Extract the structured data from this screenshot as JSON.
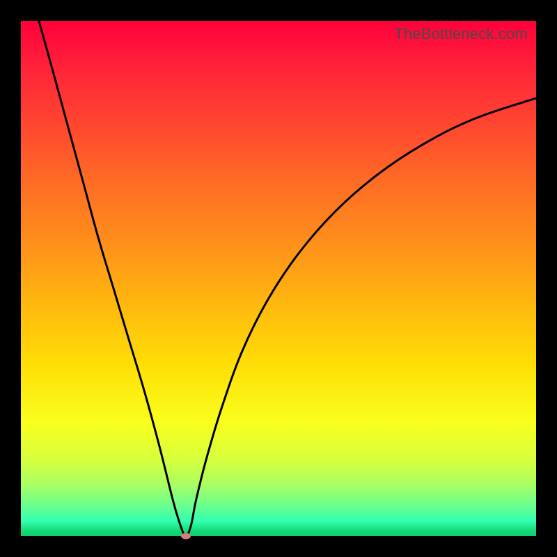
{
  "watermark": "TheBottleneck.com",
  "chart_data": {
    "type": "line",
    "title": "",
    "xlabel": "",
    "ylabel": "",
    "xlim": [
      0,
      100
    ],
    "ylim": [
      0,
      100
    ],
    "grid": false,
    "legend": false,
    "gradient_stops": [
      {
        "pos": 0,
        "color": "#ff003a"
      },
      {
        "pos": 20,
        "color": "#ff4630"
      },
      {
        "pos": 44,
        "color": "#ff921a"
      },
      {
        "pos": 67,
        "color": "#ffdf06"
      },
      {
        "pos": 85,
        "color": "#d8ff3c"
      },
      {
        "pos": 97,
        "color": "#34ffb0"
      },
      {
        "pos": 100,
        "color": "#0fcf70"
      }
    ],
    "series": [
      {
        "name": "bottleneck-curve",
        "color": "#000000",
        "x": [
          3.5,
          6,
          9,
          12,
          15,
          18,
          21,
          24,
          27,
          29.5,
          31,
          32,
          33,
          34,
          36,
          39,
          43,
          48,
          54,
          61,
          69,
          78,
          88,
          100
        ],
        "values": [
          100,
          91,
          80,
          69,
          58,
          48,
          38,
          28,
          17,
          7,
          2,
          0,
          2,
          7,
          15,
          25,
          36,
          46,
          55,
          63,
          70,
          76,
          81,
          85
        ]
      }
    ],
    "marker": {
      "x": 32,
      "y": 0,
      "color": "#d97a7a"
    }
  }
}
